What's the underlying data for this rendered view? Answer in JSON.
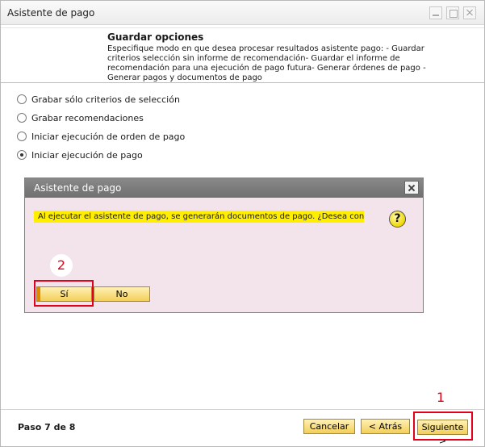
{
  "window": {
    "title": "Asistente de pago"
  },
  "header": {
    "title": "Guardar opciones",
    "description": "Especifique modo en que desea procesar resultados asistente pago: - Guardar criterios selección sin informe de recomendación- Guardar el informe de recomendación para una ejecución de pago futura- Generar órdenes de pago - Generar pagos y documentos de pago"
  },
  "options": [
    {
      "label": "Grabar sólo criterios de selección",
      "checked": false
    },
    {
      "label": "Grabar recomendaciones",
      "checked": false
    },
    {
      "label": "Iniciar ejecución de orden de pago",
      "checked": false
    },
    {
      "label": "Iniciar ejecución de pago",
      "checked": true
    }
  ],
  "dialog": {
    "title": "Asistente de pago",
    "message": "Al ejecutar el asistente de pago, se generarán documentos de pago. ¿Desea continuar?",
    "icon": "question-icon",
    "yes_label": "Sí",
    "no_label": "No"
  },
  "annotations": {
    "callout_1": "1",
    "callout_2": "2",
    "highlight_color": "#e3001b"
  },
  "footer": {
    "step": "Paso 7 de 8",
    "cancel_label": "Cancelar",
    "back_label": "< Atrás",
    "next_label": "Siguiente >"
  },
  "colors": {
    "button_gold": "#f3cf5a",
    "message_yellow": "#ffee00",
    "dialog_bg": "#f3e4ec"
  }
}
